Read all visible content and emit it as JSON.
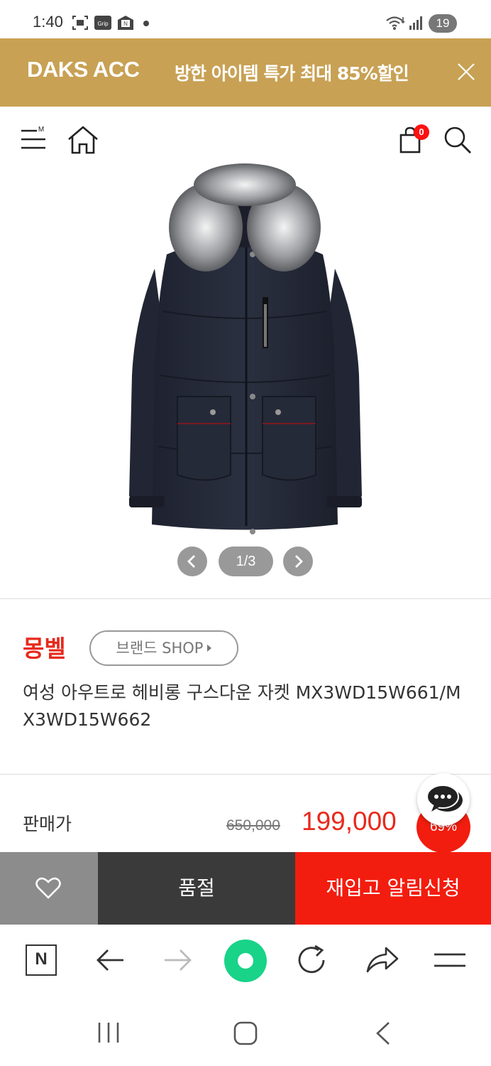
{
  "status_bar": {
    "time": "1:40",
    "icon_label_grip": "Grip",
    "icon_label_n": "N",
    "battery": "19"
  },
  "promo": {
    "brand": "DAKS ACC",
    "text": "방한 아이템 특가 최대 85%할인",
    "bg_color": "#c8a154"
  },
  "header": {
    "menu_superscript": "M",
    "cart_count": "0"
  },
  "gallery": {
    "counter": "1/3"
  },
  "product": {
    "brand": "몽벨",
    "brand_shop_label": "브랜드 SHOP",
    "title": "여성 아우트로 헤비롱 구스다운 자켓 MX3WD15W661/MX3WD15W662"
  },
  "price": {
    "label": "판매가",
    "original": "650,000",
    "sale": "199,000",
    "discount": "69%",
    "accent_color": "#e8291c"
  },
  "actions": {
    "soldout_label": "품절",
    "restock_label": "재입고 알림신청"
  },
  "browser_bar": {
    "home_letter": "N"
  }
}
